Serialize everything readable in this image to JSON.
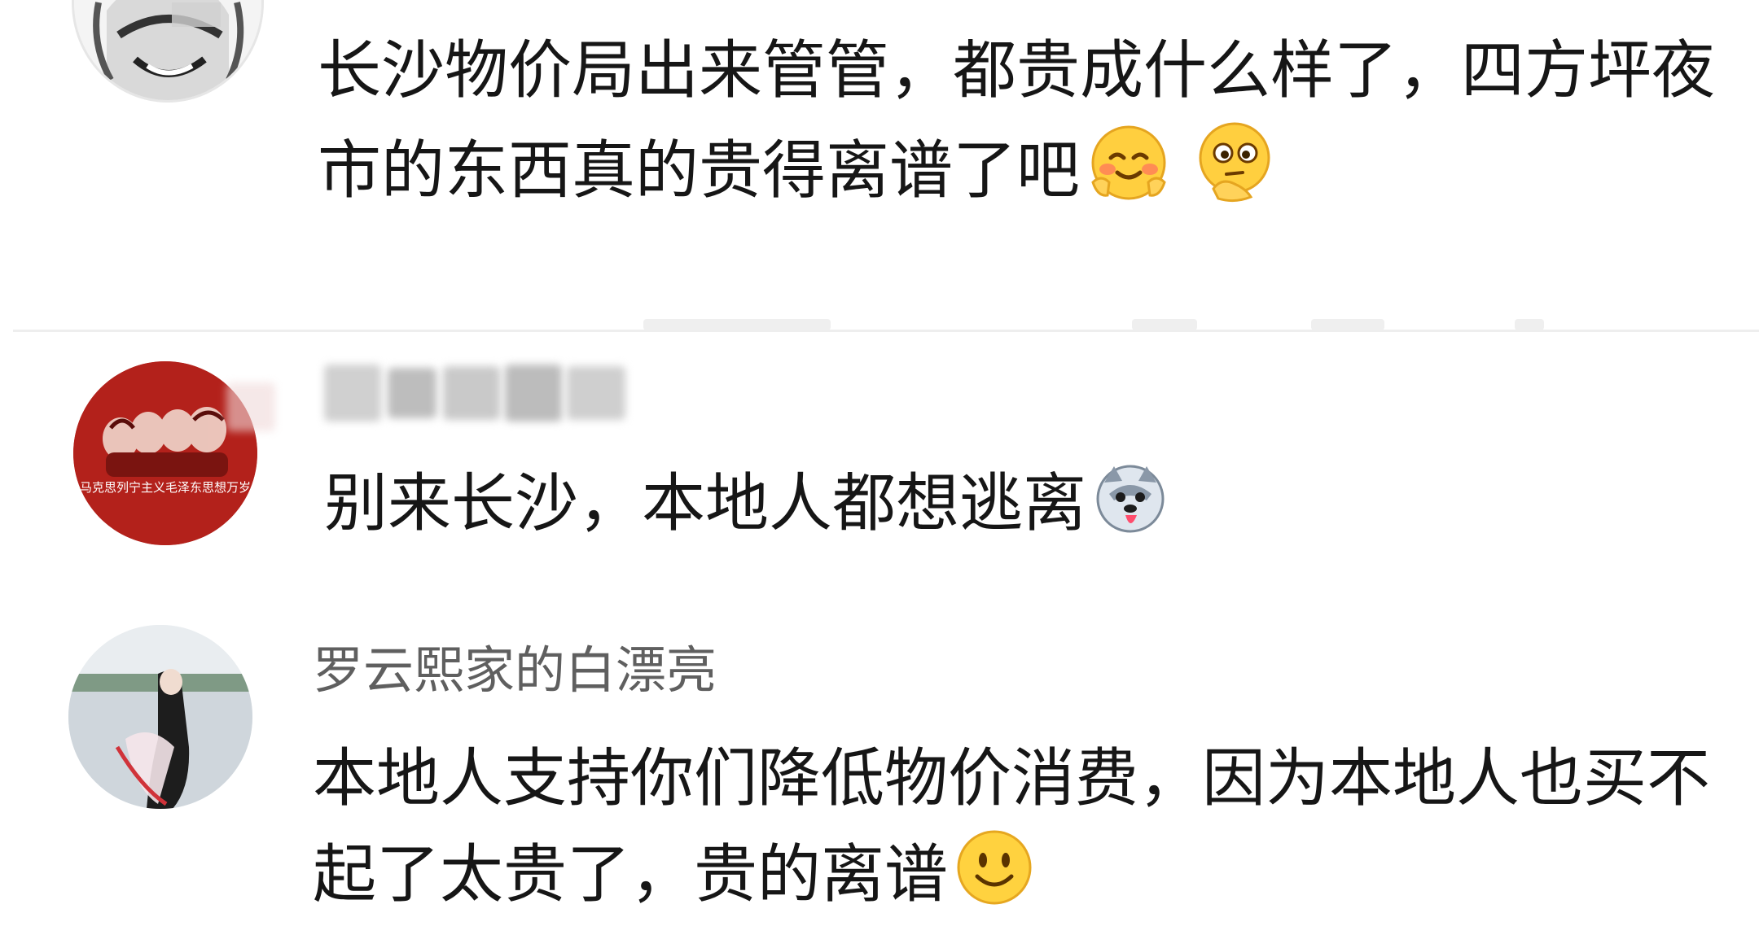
{
  "comments": [
    {
      "username": "",
      "text": "长沙物价局出来管管，都贵成什么样了，四方坪夜市的东西真的贵得离谱了吧",
      "emojis": [
        "blushing-smile-emoji",
        "thinking-hand-on-chin-emoji"
      ]
    },
    {
      "username": "",
      "text": "别来长沙，本地人都想逃离",
      "emojis": [
        "husky-dog-tongue-emoji"
      ],
      "avatar_caption": "马克思列宁主义毛泽东思想万岁"
    },
    {
      "username": "罗云熙家的白漂亮",
      "text": "本地人支持你们降低物价消费，因为本地人也买不起了太贵了，贵的离谱",
      "emojis": [
        "smile-emoji"
      ]
    }
  ],
  "colors": {
    "avatar_red": "#b3211b",
    "username_gray": "#5f5f5f",
    "text_dark": "#161616",
    "divider": "#eeeeee"
  }
}
